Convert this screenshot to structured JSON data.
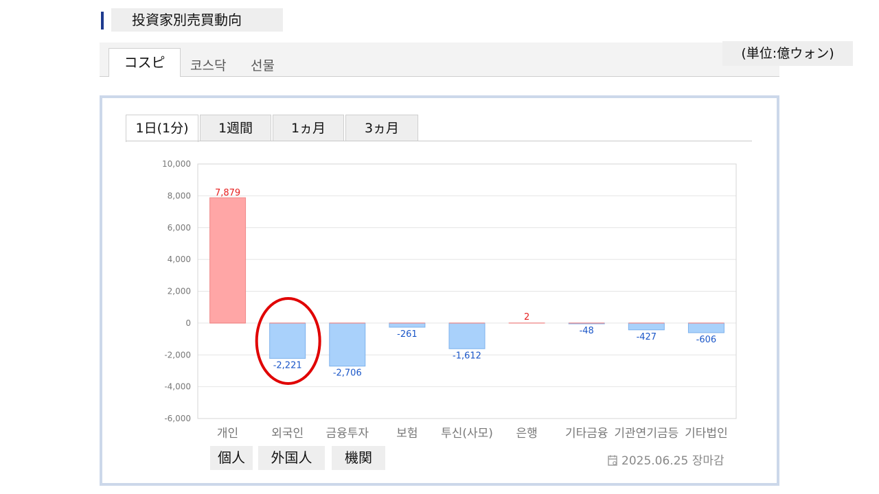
{
  "section": {
    "title": "投資家別売買動向"
  },
  "market_tabs": [
    "コスピ",
    "코스닥",
    "선물"
  ],
  "unit_label": "(単位:億ウォン)",
  "period_tabs": [
    "1日(1分)",
    "1週間",
    "1ヵ月",
    "3ヵ月"
  ],
  "translation_labels": [
    "個人",
    "外国人",
    "機関"
  ],
  "footer": {
    "date_text": "2025.06.25 장마감",
    "icon": "calendar-icon"
  },
  "colors": {
    "positive_fill": "#ffa6a6",
    "negative_fill": "#a9d1fb",
    "positive_text": "#e61e1e",
    "negative_text": "#1a56c8",
    "highlight": "#e00000",
    "header_bar": "#1f3b8f"
  },
  "highlight": {
    "category": "외국인",
    "shape": "ellipse"
  },
  "chart_data": {
    "type": "bar",
    "categories": [
      "개인",
      "외국인",
      "금융투자",
      "보험",
      "투신(사모)",
      "은행",
      "기타금융",
      "기관연기금등",
      "기타법인"
    ],
    "values": [
      7879,
      -2221,
      -2706,
      -261,
      -1612,
      2,
      -48,
      -427,
      -606
    ],
    "value_labels": [
      "7,879",
      "-2,221",
      "-2,706",
      "-261",
      "-1,612",
      "2",
      "-48",
      "-427",
      "-606"
    ],
    "ylim": [
      -6000,
      10000
    ],
    "yticks": [
      10000,
      8000,
      6000,
      4000,
      2000,
      0,
      -2000,
      -4000,
      -6000
    ],
    "ytick_labels": [
      "10,000",
      "8,000",
      "6,000",
      "4,000",
      "2,000",
      "0",
      "-2,000",
      "-4,000",
      "-6,000"
    ],
    "grid": true,
    "title": "",
    "xlabel": "",
    "ylabel": ""
  }
}
